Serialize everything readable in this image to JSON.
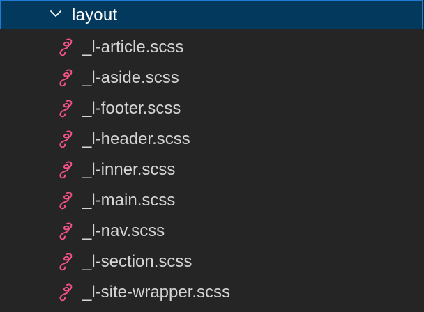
{
  "explorer": {
    "folder": {
      "name": "layout",
      "expanded": true,
      "icon": "chevron-down-icon"
    },
    "files": [
      {
        "name": "_l-article.scss",
        "icon": "sass-icon"
      },
      {
        "name": "_l-aside.scss",
        "icon": "sass-icon"
      },
      {
        "name": "_l-footer.scss",
        "icon": "sass-icon"
      },
      {
        "name": "_l-header.scss",
        "icon": "sass-icon"
      },
      {
        "name": "_l-inner.scss",
        "icon": "sass-icon"
      },
      {
        "name": "_l-main.scss",
        "icon": "sass-icon"
      },
      {
        "name": "_l-nav.scss",
        "icon": "sass-icon"
      },
      {
        "name": "_l-section.scss",
        "icon": "sass-icon"
      },
      {
        "name": "_l-site-wrapper.scss",
        "icon": "sass-icon"
      }
    ],
    "colors": {
      "background": "#252526",
      "selected_background": "#04395e",
      "selected_border": "#1f7ad1",
      "sass_icon": "#f55385",
      "text": "#d4d4d4"
    }
  }
}
